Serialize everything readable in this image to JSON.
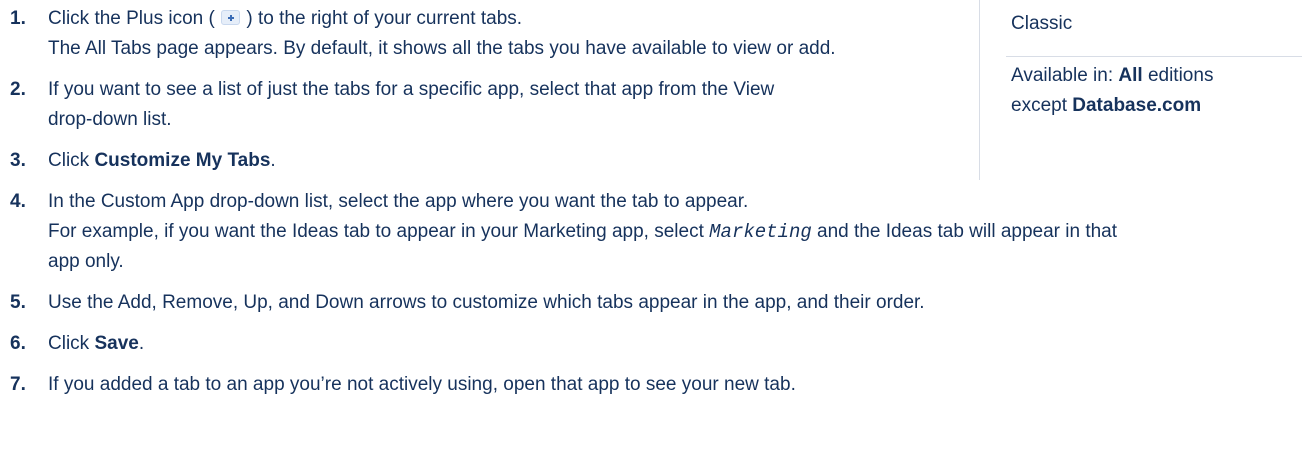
{
  "steps": [
    {
      "num": "1.",
      "line1_a": "Click the Plus icon (",
      "line1_b": ") to the right of your current tabs.",
      "line2": "The All Tabs page appears. By default, it shows all the tabs you have available to view or add."
    },
    {
      "num": "2.",
      "line1": "If you want to see a list of just the tabs for a specific app, select that app from the View",
      "line2": "drop-down list."
    },
    {
      "num": "3.",
      "pre": "Click ",
      "bold": "Customize My Tabs",
      "post": "."
    },
    {
      "num": "4.",
      "line1": "In the Custom App drop-down list, select the app where you want the tab to appear.",
      "line2_a": "For example, if you want the Ideas tab to appear in your Marketing app, select ",
      "line2_code": "Marketing",
      "line2_b": " and the Ideas tab will appear in that",
      "line3": "app only."
    },
    {
      "num": "5.",
      "text": "Use the Add, Remove, Up, and Down arrows to customize which tabs appear in the app, and their order."
    },
    {
      "num": "6.",
      "pre": "Click ",
      "bold": "Save",
      "post": "."
    },
    {
      "num": "7.",
      "text": "If you added a tab to an app you’re not actively using, open that app to see your new tab."
    }
  ],
  "sidebar": {
    "edition": "Classic",
    "avail_prefix": "Available in: ",
    "avail_bold": "All",
    "avail_suffix": " editions",
    "except_prefix": "except ",
    "except_bold": "Database.com"
  },
  "icons": {
    "plus": "plus-icon"
  },
  "colors": {
    "text": "#16325c",
    "divider": "#d8dde6"
  }
}
